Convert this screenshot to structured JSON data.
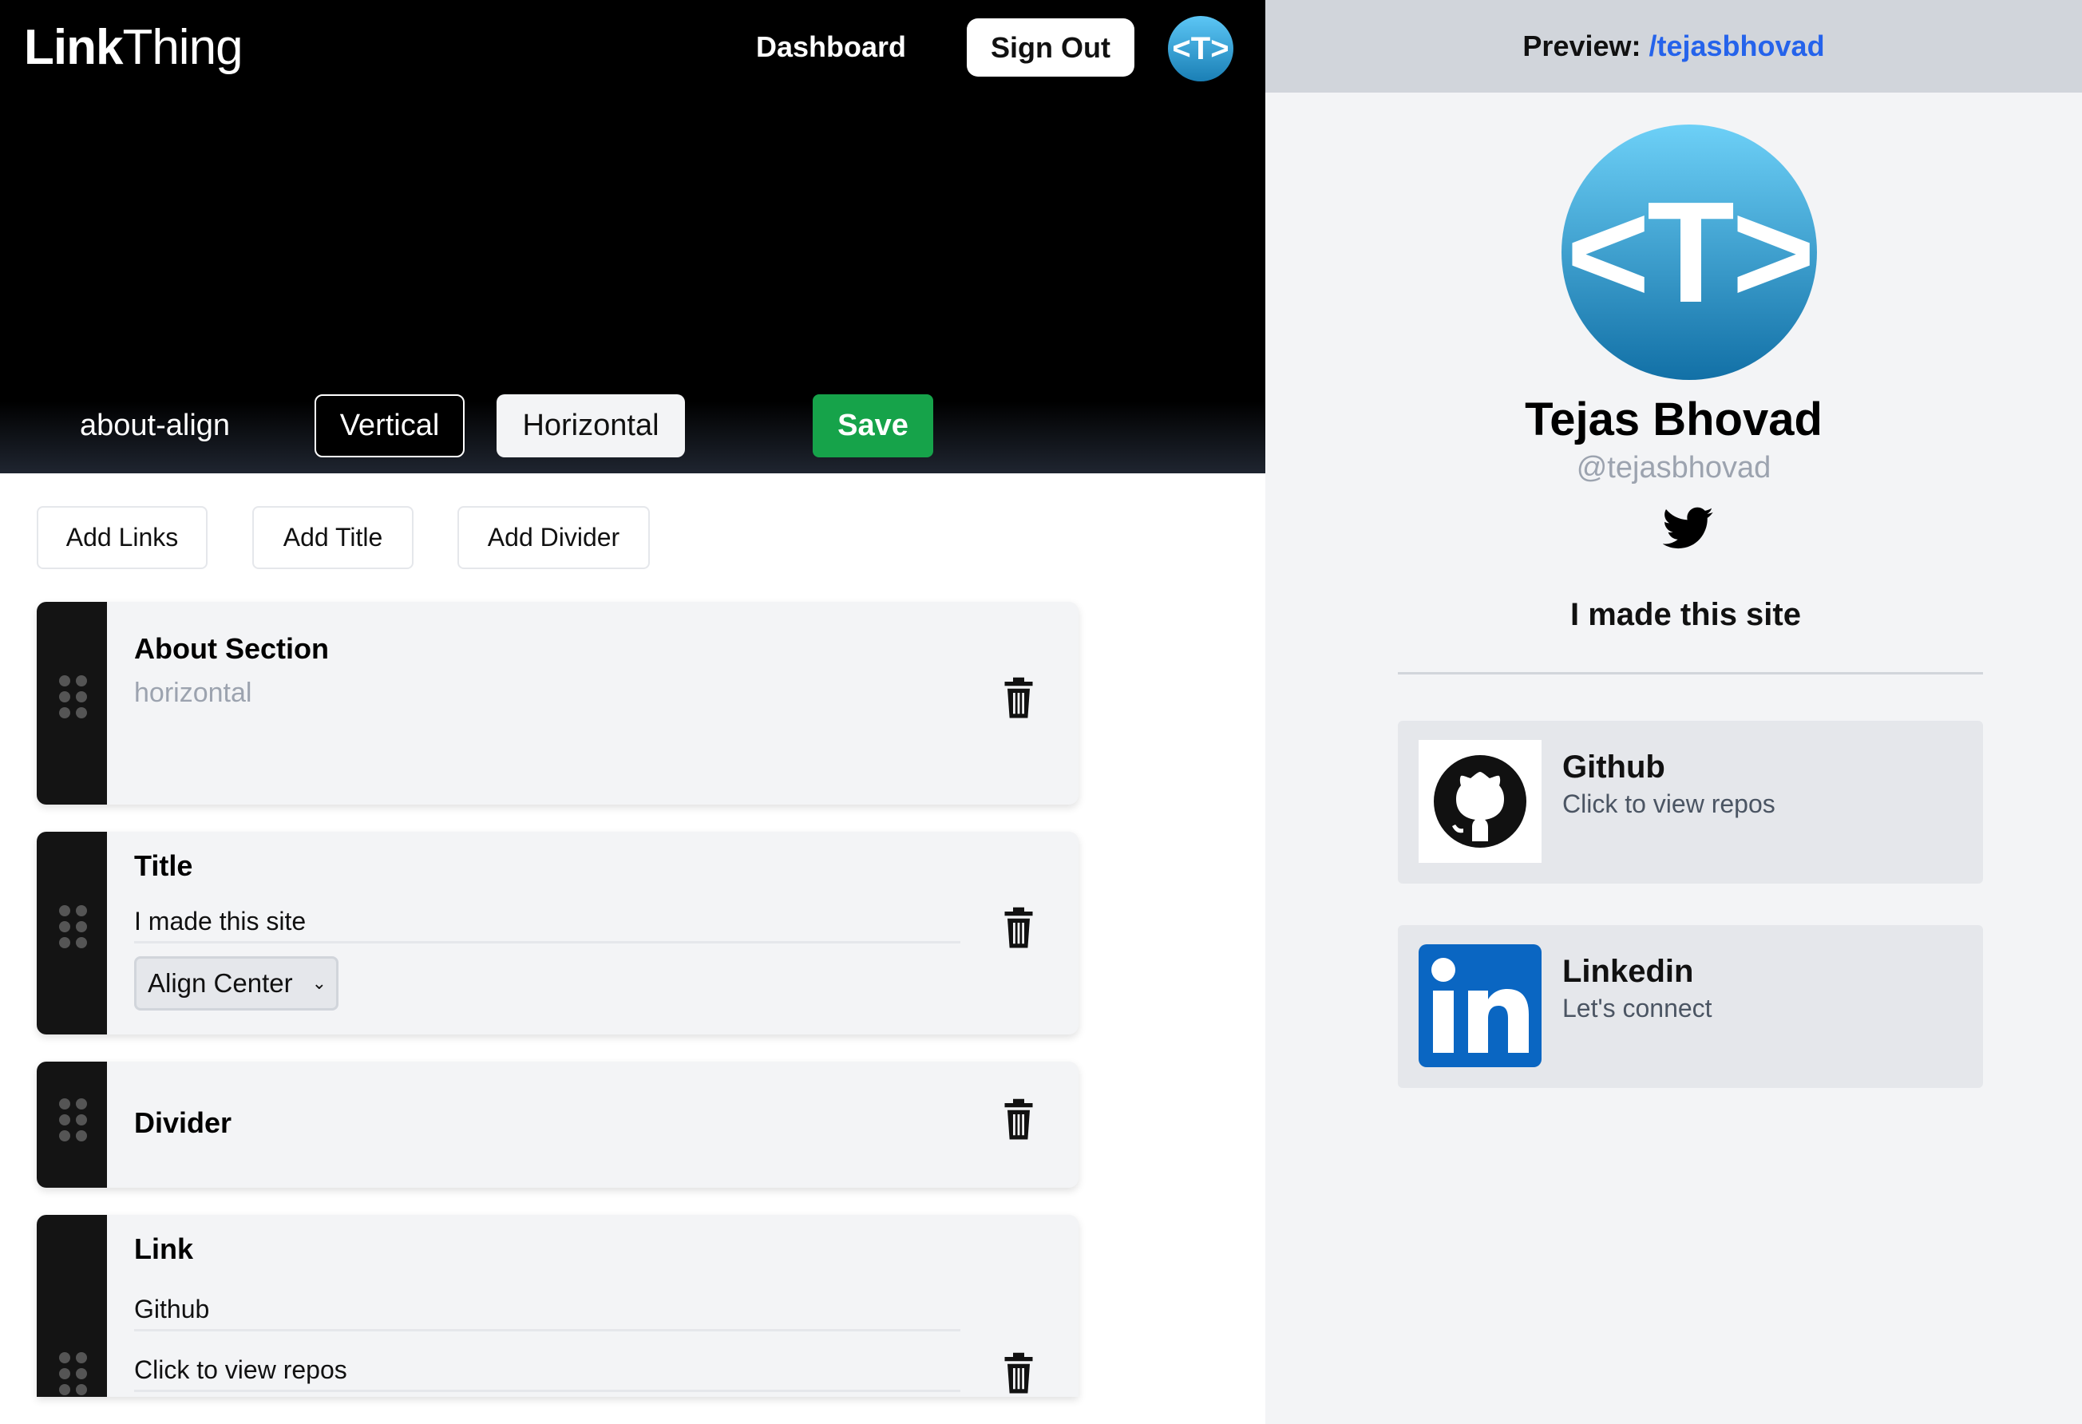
{
  "header": {
    "logo_bold": "Link",
    "logo_light": "Thing",
    "nav_dashboard": "Dashboard",
    "sign_out": "Sign Out",
    "avatar_text": "<T>"
  },
  "toolbar": {
    "align_label": "about-align",
    "vertical": "Vertical",
    "horizontal": "Horizontal",
    "save": "Save"
  },
  "add_buttons": {
    "links": "Add Links",
    "title": "Add Title",
    "divider": "Add Divider"
  },
  "cards": {
    "about": {
      "title": "About Section",
      "subtitle": "horizontal"
    },
    "title": {
      "title": "Title",
      "value": "I made this site",
      "align": "Align Center"
    },
    "divider": {
      "title": "Divider"
    },
    "link": {
      "title": "Link",
      "name_value": "Github",
      "desc_value": "Click to view repos"
    }
  },
  "preview": {
    "label": "Preview:",
    "path": "/tejasbhovad",
    "avatar_text": "<T>",
    "name": "Tejas Bhovad",
    "handle": "@tejasbhovad",
    "social_icon": "twitter-icon",
    "title": "I made this site",
    "links": [
      {
        "title": "Github",
        "desc": "Click to view repos",
        "icon": "github-icon"
      },
      {
        "title": "Linkedin",
        "desc": "Let's connect",
        "icon": "linkedin-icon"
      }
    ]
  },
  "colors": {
    "save_green": "#16a34a",
    "link_blue": "#2563eb",
    "avatar_blue": "#1a7fb5",
    "linkedin_blue": "#0a66c2"
  }
}
